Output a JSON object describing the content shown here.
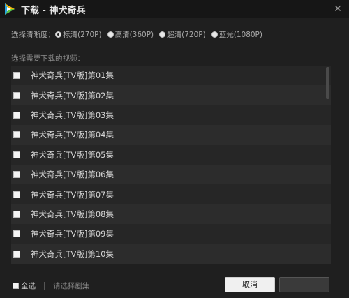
{
  "window": {
    "title": "下载 - 神犬奇兵",
    "close_glyph": "✕"
  },
  "quality": {
    "label": "选择清晰度：",
    "options": [
      {
        "label": "标清(270P)",
        "checked": true
      },
      {
        "label": "高清(360P)",
        "checked": false
      },
      {
        "label": "超清(720P)",
        "checked": false
      },
      {
        "label": "蓝光(1080P)",
        "checked": false
      }
    ]
  },
  "list": {
    "label": "选择需要下载的视频：",
    "items": [
      "神犬奇兵[TV版]第01集",
      "神犬奇兵[TV版]第02集",
      "神犬奇兵[TV版]第03集",
      "神犬奇兵[TV版]第04集",
      "神犬奇兵[TV版]第05集",
      "神犬奇兵[TV版]第06集",
      "神犬奇兵[TV版]第07集",
      "神犬奇兵[TV版]第08集",
      "神犬奇兵[TV版]第09集",
      "神犬奇兵[TV版]第10集"
    ]
  },
  "footer": {
    "select_all": "全选",
    "select_episodes": "请选择剧集",
    "cancel": "取消",
    "ok": ""
  },
  "colors": {
    "accent": "#2aa6e0",
    "background": "#1f1f1f"
  },
  "icons": {
    "logo": "video-play-logo-icon"
  }
}
